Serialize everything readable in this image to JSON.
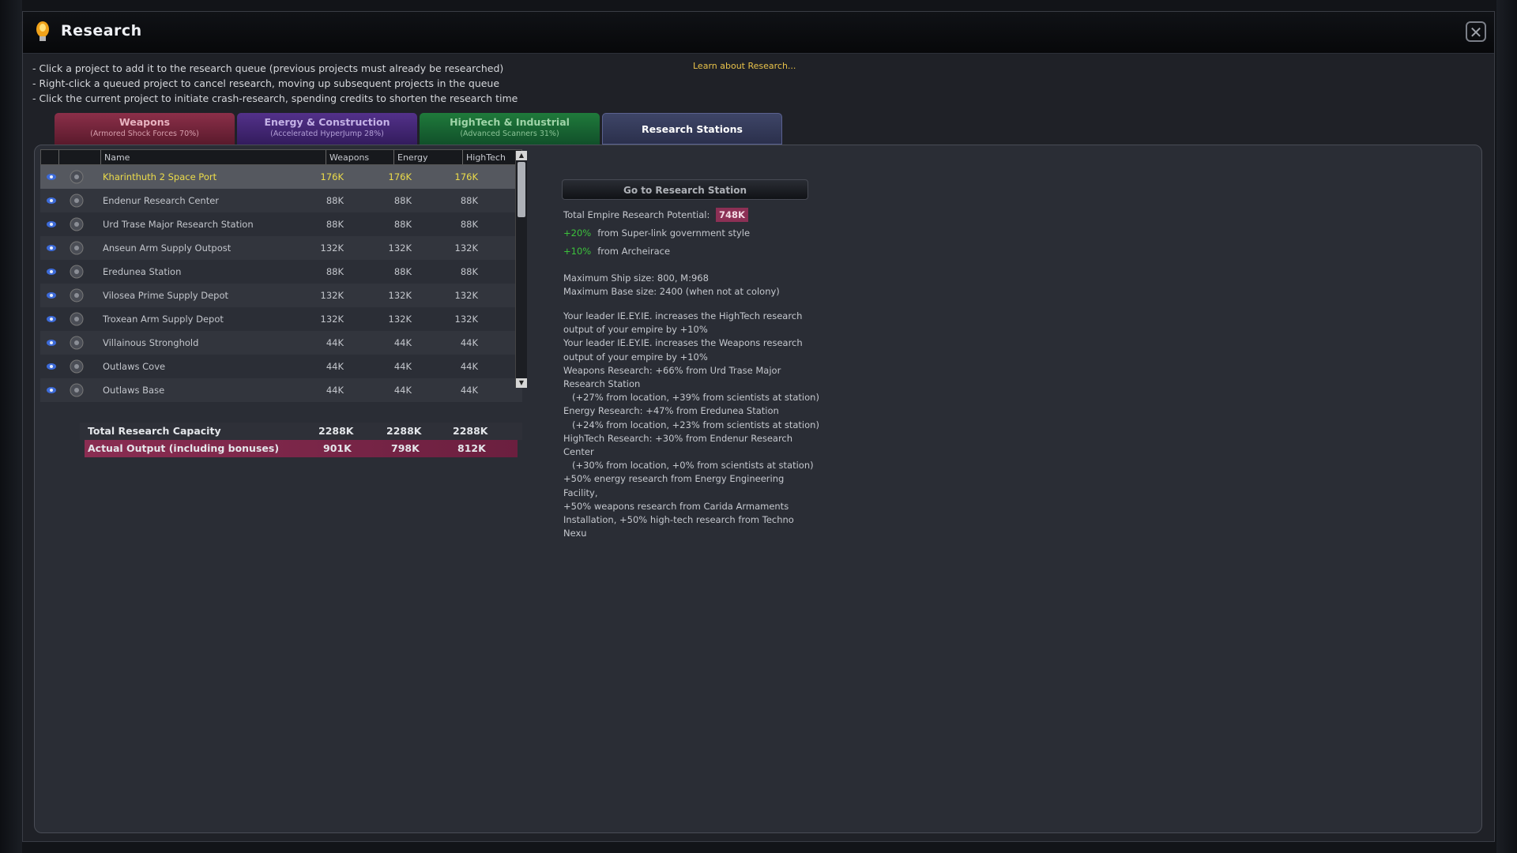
{
  "window": {
    "title": "Research",
    "close_label": "✕"
  },
  "hints": [
    "- Click a project to add it to the research queue (previous projects must already be researched)",
    "- Right-click a queued project to cancel research, moving up subsequent projects in the queue",
    "- Click the current project to initiate crash-research, spending credits to shorten the research time"
  ],
  "learn_link": "Learn about Research...",
  "tabs": [
    {
      "label": "Weapons",
      "sub": "(Armored Shock Forces 70%)"
    },
    {
      "label": "Energy & Construction",
      "sub": "(Accelerated HyperJump 28%)"
    },
    {
      "label": "HighTech & Industrial",
      "sub": "(Advanced Scanners 31%)"
    },
    {
      "label": "Research Stations",
      "sub": ""
    }
  ],
  "table": {
    "columns": [
      "Name",
      "Weapons",
      "Energy",
      "HighTech"
    ],
    "rows": [
      {
        "name": "Kharinthuth 2 Space Port",
        "weapons": "176K",
        "energy": "176K",
        "hightech": "176K",
        "icon": "space-port-icon"
      },
      {
        "name": "Endenur Research Center",
        "weapons": "88K",
        "energy": "88K",
        "hightech": "88K",
        "icon": "research-station-icon"
      },
      {
        "name": "Urd Trase Major Research Station",
        "weapons": "88K",
        "energy": "88K",
        "hightech": "88K",
        "icon": "research-station-icon"
      },
      {
        "name": "Anseun Arm Supply Outpost",
        "weapons": "132K",
        "energy": "132K",
        "hightech": "132K",
        "icon": "supply-outpost-icon"
      },
      {
        "name": "Eredunea Station",
        "weapons": "88K",
        "energy": "88K",
        "hightech": "88K",
        "icon": "research-station-icon"
      },
      {
        "name": "Vilosea Prime Supply Depot",
        "weapons": "132K",
        "energy": "132K",
        "hightech": "132K",
        "icon": "supply-depot-icon"
      },
      {
        "name": "Troxean Arm Supply Depot",
        "weapons": "132K",
        "energy": "132K",
        "hightech": "132K",
        "icon": "supply-depot-icon"
      },
      {
        "name": "Villainous Stronghold",
        "weapons": "44K",
        "energy": "44K",
        "hightech": "44K",
        "icon": "pirate-base-icon"
      },
      {
        "name": "Outlaws Cove",
        "weapons": "44K",
        "energy": "44K",
        "hightech": "44K",
        "icon": "pirate-base-icon"
      },
      {
        "name": "Outlaws Base",
        "weapons": "44K",
        "energy": "44K",
        "hightech": "44K",
        "icon": "research-station-icon"
      }
    ]
  },
  "totals": {
    "capacity": {
      "label": "Total Research Capacity",
      "weapons": "2288K",
      "energy": "2288K",
      "hightech": "2288K"
    },
    "actual": {
      "label": "Actual Output (including bonuses)",
      "weapons": "901K",
      "energy": "798K",
      "hightech": "812K"
    }
  },
  "go_button": "Go to Research Station",
  "potential": {
    "label": "Total Empire Research Potential:",
    "value": "748K",
    "bonus1_pct": "+20%",
    "bonus1_text": "from Super-link government style",
    "bonus2_pct": "+10%",
    "bonus2_text": "from Archeirace"
  },
  "sizes": {
    "ship": "Maximum Ship size: 800, M:968",
    "base": "Maximum Base size: 2400 (when not at colony)"
  },
  "notes": [
    "Your leader IE.EY.IE. increases the HighTech research",
    "output of your empire by +10%",
    "Your leader IE.EY.IE. increases the Weapons research",
    "output of your empire by +10%",
    "Weapons Research: +66% from Urd Trase Major",
    "Research Station",
    "   (+27% from location, +39% from scientists at station)",
    "Energy Research: +47% from Eredunea Station",
    "   (+24% from location, +23% from scientists at station)",
    "HighTech Research: +30% from Endenur Research",
    "Center",
    "   (+30% from location, +0% from scientists at station)",
    "+50% energy research from Energy Engineering Facility,",
    "+50% weapons research from Carida Armaments",
    "Installation, +50% high-tech research from Techno Nexu"
  ],
  "colors": {
    "selected_text": "#ecdc4a",
    "actual_output_bar": "#8a2d52",
    "bonus_green": "#3cc23c",
    "learn_link": "#e8c24a"
  }
}
